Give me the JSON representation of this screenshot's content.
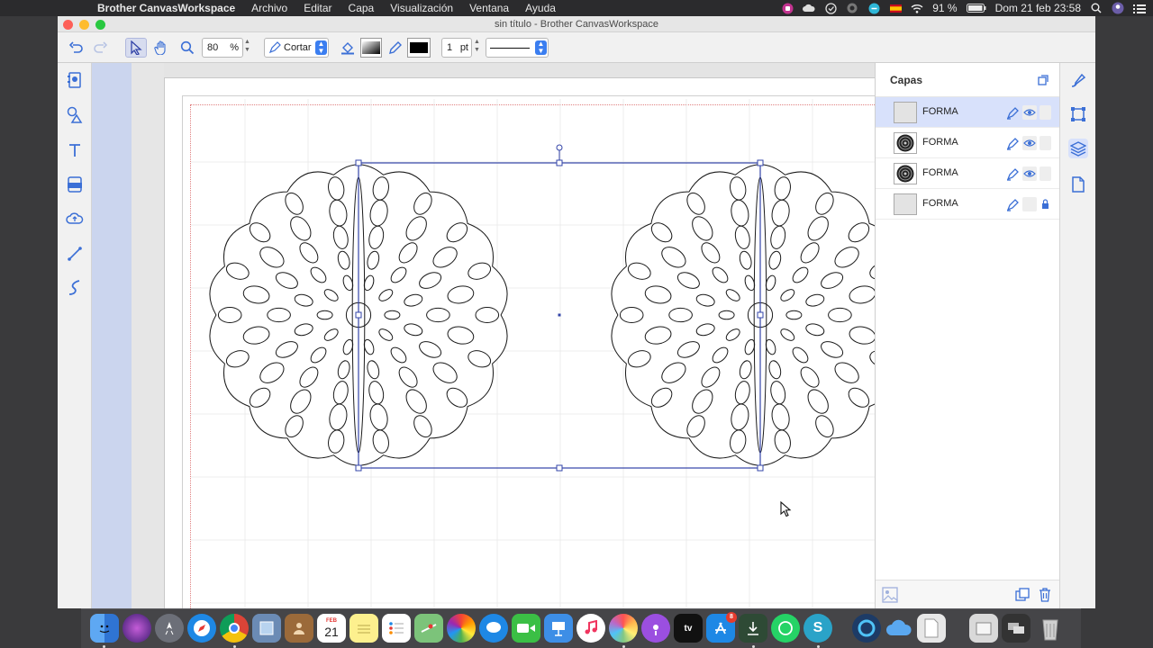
{
  "menubar": {
    "app_name": "Brother CanvasWorkspace",
    "menus": [
      "Archivo",
      "Editar",
      "Capa",
      "Visualización",
      "Ventana",
      "Ayuda"
    ],
    "battery": "91 %",
    "clock": "Dom 21 feb  23:58"
  },
  "window": {
    "title": "sin título - Brother CanvasWorkspace"
  },
  "toolbar": {
    "zoom_value": "80",
    "zoom_unit": "%",
    "mode_label": "Cortar",
    "line_width_value": "1",
    "line_width_unit": "pt"
  },
  "layers_panel": {
    "title": "Capas",
    "layers": [
      {
        "name": "FORMA",
        "selected": true,
        "locked": false,
        "thumbnail": "blank"
      },
      {
        "name": "FORMA",
        "selected": false,
        "locked": false,
        "thumbnail": "mandala"
      },
      {
        "name": "FORMA",
        "selected": false,
        "locked": false,
        "thumbnail": "mandala"
      },
      {
        "name": "FORMA",
        "selected": false,
        "locked": true,
        "thumbnail": "blank"
      }
    ]
  },
  "dock": {
    "calendar_month": "FEB",
    "calendar_day": "21",
    "appstore_badge": "8"
  },
  "colors": {
    "selection": "#3344a8",
    "accent": "#3b7ef0",
    "panel_selected": "#d8e1fb",
    "ruler": "#cbd5ee"
  }
}
